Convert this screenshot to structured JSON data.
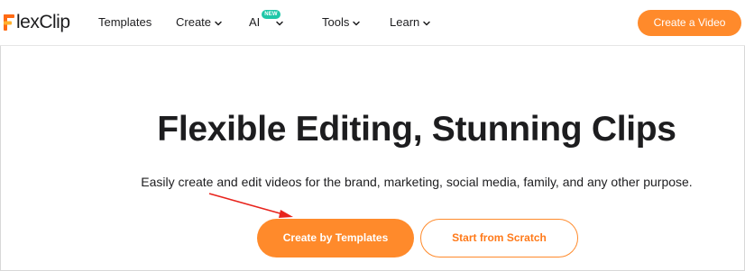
{
  "header": {
    "logo_text": "lexClip",
    "nav": [
      {
        "label": "Templates"
      },
      {
        "label": "Create"
      },
      {
        "label": "AI",
        "badge": "NEW"
      },
      {
        "label": "Tools"
      },
      {
        "label": "Learn"
      }
    ],
    "cta_label": "Create a Video"
  },
  "hero": {
    "title": "Flexible Editing, Stunning Clips",
    "subtitle": "Easily create and edit videos for the brand, marketing, social media, family, and any other purpose.",
    "primary_button": "Create by Templates",
    "secondary_button": "Start from Scratch"
  },
  "colors": {
    "accent": "#ff8a2b",
    "badge": "#1fc7a8",
    "annotation_arrow": "#e8231c"
  }
}
